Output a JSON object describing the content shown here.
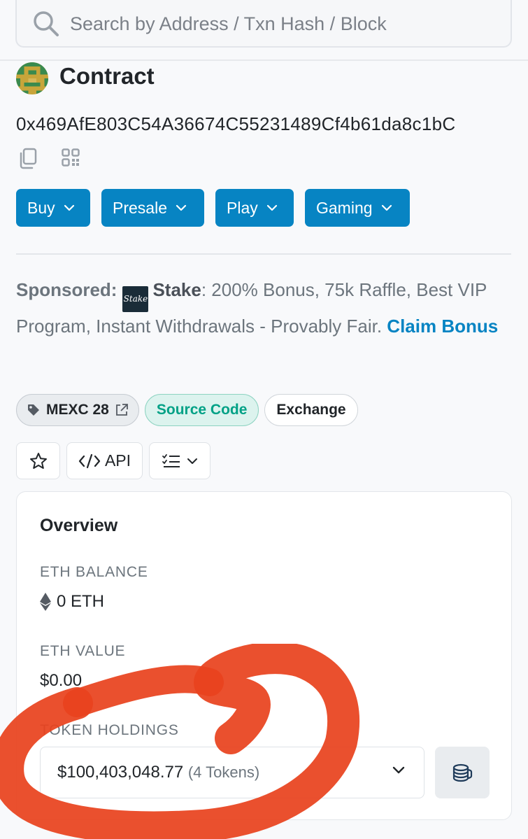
{
  "search": {
    "placeholder": "Search by Address / Txn Hash / Block"
  },
  "contract": {
    "title": "Contract",
    "address": "0x469AfE803C54A36674C55231489Cf4b61da8c1bC"
  },
  "menus": [
    {
      "label": "Buy"
    },
    {
      "label": "Presale"
    },
    {
      "label": "Play"
    },
    {
      "label": "Gaming"
    }
  ],
  "sponsored": {
    "label": "Sponsored:",
    "logo_text": "Stake",
    "brand": "Stake",
    "text": ": 200% Bonus, 75k Raffle, Best VIP Program, Instant Withdrawals - Provably Fair. ",
    "cta": "Claim Bonus"
  },
  "tags": {
    "mexc": "MEXC 28",
    "source": "Source Code",
    "exchange": "Exchange"
  },
  "actions": {
    "api_label": "API"
  },
  "overview": {
    "title": "Overview",
    "eth_balance_label": "ETH BALANCE",
    "eth_balance_value": "0 ETH",
    "eth_value_label": "ETH VALUE",
    "eth_value_value": "$0.00",
    "token_holdings_label": "TOKEN HOLDINGS",
    "token_holdings_value": "$100,403,048.77",
    "token_holdings_count": "(4 Tokens)"
  },
  "colors": {
    "primary": "#0784c3",
    "success": "#00a186",
    "annotation": "#e8431e"
  }
}
